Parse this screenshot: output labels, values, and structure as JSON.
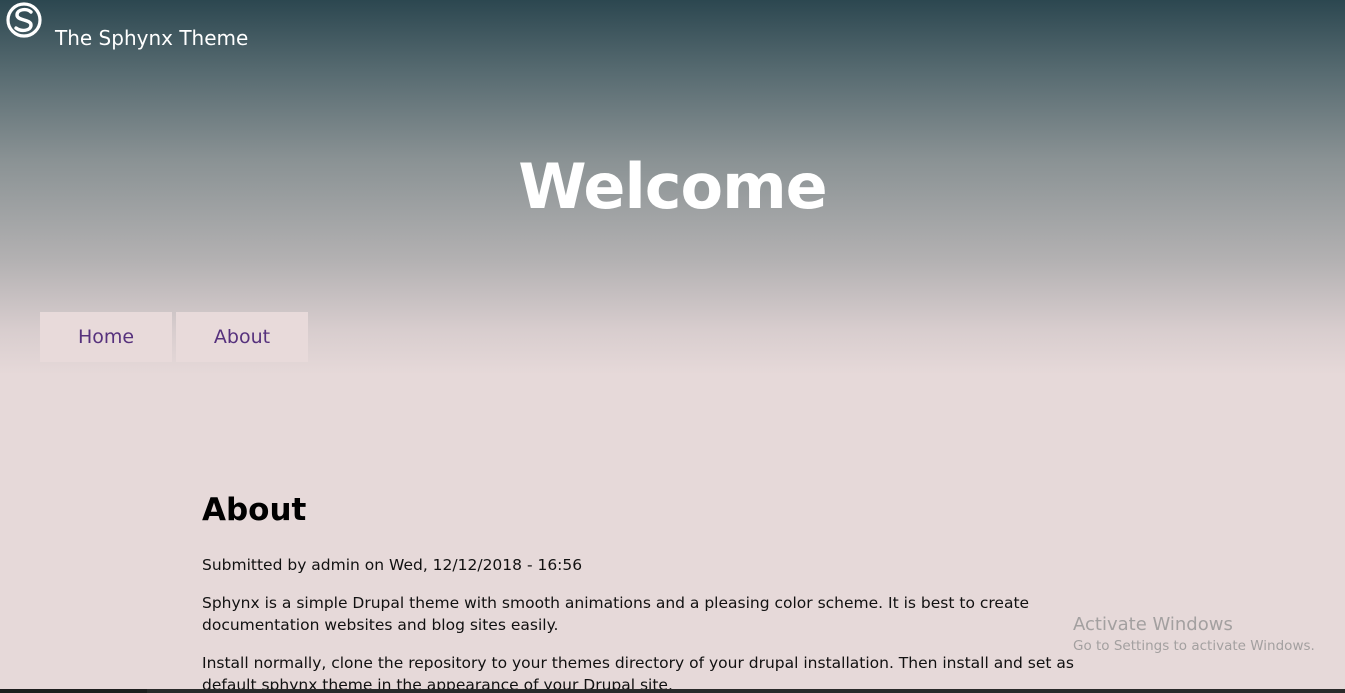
{
  "header": {
    "logo_icon": "sphynx-logo-icon",
    "site_name": "The Sphynx Theme"
  },
  "hero": {
    "title": "Welcome"
  },
  "nav": {
    "items": [
      {
        "label": "Home"
      },
      {
        "label": "About"
      }
    ]
  },
  "article": {
    "title": "About",
    "meta": "Submitted by admin on Wed, 12/12/2018 - 16:56",
    "paragraphs": [
      "Sphynx is a simple Drupal theme with smooth animations and a pleasing color scheme. It is best to create documentation websites and blog sites easily.",
      "Install normally, clone the repository to your themes directory of your drupal installation. Then install and set as default sphynx theme in the appearance of your Drupal site."
    ]
  },
  "watermark": {
    "title": "Activate Windows",
    "subtitle": "Go to Settings to activate Windows."
  },
  "colors": {
    "header_top": "#2c4750",
    "page_background": "#e6d9d9",
    "nav_background": "#e8dada",
    "nav_text": "#56317d"
  }
}
